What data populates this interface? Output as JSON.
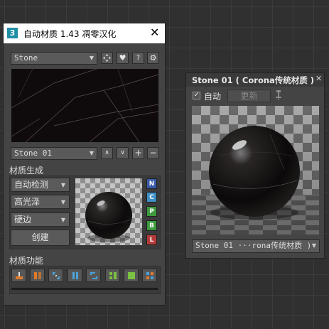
{
  "tool_window": {
    "app_icon_text": "3",
    "title": "自动材质 1.43 凋零汉化",
    "material_preset": "Stone",
    "material_slot": "Stone 01",
    "section_generate": "材质生成",
    "detect_mode": "自动检测",
    "gloss_mode": "高光泽",
    "edge_mode": "硬边",
    "create_label": "创建",
    "map_letters": [
      {
        "letter": "N",
        "color": "#3a5ba8"
      },
      {
        "letter": "C",
        "color": "#3f8fc4"
      },
      {
        "letter": "P",
        "color": "#3d9a3d"
      },
      {
        "letter": "B",
        "color": "#3d9a3d"
      },
      {
        "letter": "L",
        "color": "#b53a3a"
      }
    ],
    "section_functions": "材质功能"
  },
  "preview_window": {
    "title": "Stone 01 ( Corona传统材质 )",
    "auto_label": "自动",
    "update_label": "更新",
    "auto_checked": true,
    "slot_name": "Stone 01  ···rona传统材质 )"
  },
  "icons": {
    "preset_actions": [
      "move-icon",
      "heart-icon",
      "help-icon",
      "settings-icon"
    ],
    "slot_actions": [
      "chevron-up-icon",
      "chevron-down-icon",
      "plus-icon",
      "minus-icon"
    ],
    "functions": [
      "import-icon",
      "split-icon",
      "corners-icon",
      "columns-icon",
      "swap-icon",
      "grid-icon",
      "fill-square-icon",
      "quad-icon"
    ]
  }
}
